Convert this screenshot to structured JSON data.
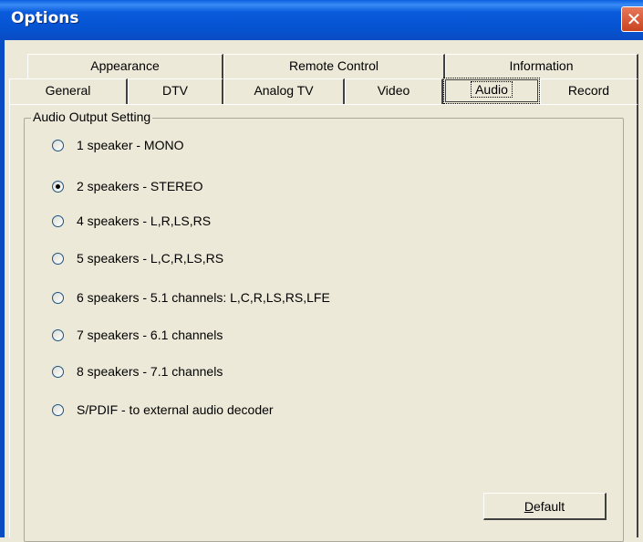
{
  "window": {
    "title": "Options",
    "close_glyph": "✕"
  },
  "tabs_row1": [
    "Appearance",
    "Remote Control",
    "Information"
  ],
  "tabs_row2": [
    "General",
    "DTV",
    "Analog TV",
    "Video",
    "Audio",
    "Record"
  ],
  "selected_tab": "Audio",
  "group": {
    "label": "Audio Output Setting"
  },
  "options": [
    "1 speaker - MONO",
    "2 speakers - STEREO",
    "4 speakers - L,R,LS,RS",
    "5 speakers - L,C,R,LS,RS",
    "6 speakers - 5.1 channels: L,C,R,LS,RS,LFE",
    "7 speakers - 6.1 channels",
    "8 speakers - 7.1 channels",
    "S/PDIF - to external audio decoder"
  ],
  "selected_option": "2 speakers - STEREO",
  "buttons": {
    "default_mnemonic": "D",
    "default_rest": "efault"
  },
  "colors": {
    "titlebar": "#0a5bdc",
    "close": "#c9431f",
    "dialog_bg": "#ece9d8"
  }
}
